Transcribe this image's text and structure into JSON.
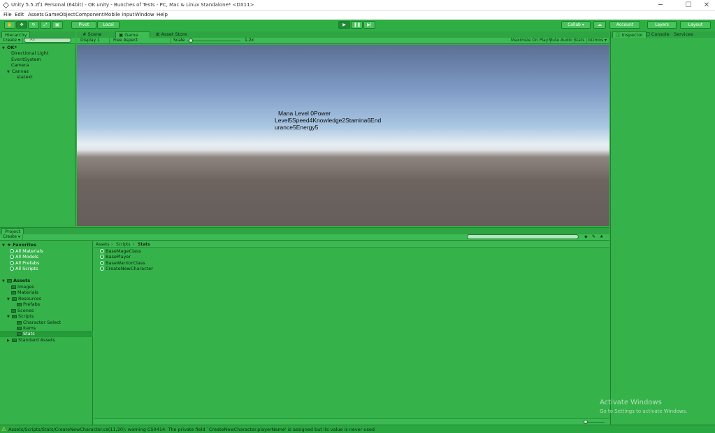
{
  "window": {
    "title": "Unity 5.5.2f1 Personal (64bit) - OK.unity - Bunches of Tests - PC, Mac & Linux Standalone* <DX11>",
    "minimize": "─",
    "maximize": "☐",
    "close": "✕"
  },
  "menu": [
    "File",
    "Edit",
    "Assets",
    "GameObject",
    "Component",
    "Mobile Input",
    "Window",
    "Help"
  ],
  "toolbar": {
    "pivot": "Pivot",
    "local": "Local",
    "collab": "Collab ▾",
    "account": "Account",
    "layers": "Layers",
    "layout": "Layout"
  },
  "hierarchy": {
    "tab": "Hierarchy",
    "create": "Create ▾",
    "search_placeholder": "All",
    "scene": "OK*",
    "items": [
      "Directional Light",
      "EventSystem",
      "Camera",
      "Canvas",
      "statext"
    ]
  },
  "scene_tabs": [
    "Scene",
    "Game",
    "Asset Store"
  ],
  "game_bar": {
    "display": "Display 1",
    "aspect": "Free Aspect",
    "scale_label": "Scale",
    "scale_value": "1.2x",
    "maximize": "Maximize On Play",
    "mute": "Mute Audio",
    "stats": "Stats",
    "gizmos": "Gizmos ▾"
  },
  "game_view": {
    "text_line1": "Mana Level 0Power",
    "text_line2": "Level5Speed4Knowledge2Stamina6End",
    "text_line3": "urance5Energy5"
  },
  "inspector": {
    "tabs": [
      "Inspector",
      "Console",
      "Services"
    ]
  },
  "project": {
    "tab": "Project",
    "create": "Create ▾",
    "breadcrumb": [
      "Assets",
      "Scripts",
      "Stats"
    ],
    "favorites_label": "Favorites",
    "favorites": [
      "All Materials",
      "All Models",
      "All Prefabs",
      "All Scripts"
    ],
    "assets_label": "Assets",
    "folders": [
      "Images",
      "Materials",
      "Resources",
      "Prefabs",
      "Scenes",
      "Scripts",
      "Character Select",
      "Items",
      "Stats",
      "Standard Assets"
    ],
    "files": [
      "BaseMageClass",
      "BasePlayer",
      "BaseWarriorClass",
      "CreateNewCharacter"
    ]
  },
  "status": {
    "message": "Assets/Scripts/Stats/CreateNewCharacter.cs(11,20): warning CS0414: The private field `CreateNewCharacter.playerName' is assigned but its value is never used"
  },
  "watermark": {
    "line1": "Activate Windows",
    "line2": "Go to Settings to activate Windows."
  }
}
